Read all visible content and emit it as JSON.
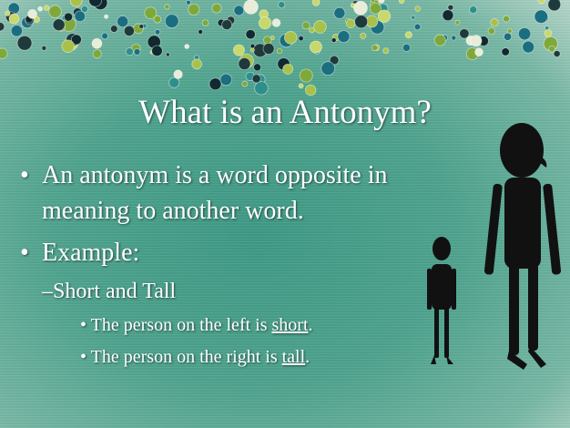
{
  "slide": {
    "title": "What is an Antonym?",
    "bullets": [
      {
        "bullet": "•",
        "line1": "An antonym is a word opposite in",
        "line2": "meaning to another word."
      },
      {
        "bullet": "•",
        "text": "Example:"
      }
    ],
    "sub_bullet": {
      "dash": "–",
      "text": "Short and Tall"
    },
    "sub_sub_bullets": [
      {
        "bullet": "•",
        "before": "The person on the left is ",
        "underlined": "short",
        "after": "."
      },
      {
        "bullet": "•",
        "before": "The person on the right is ",
        "underlined": "tall",
        "after": "."
      }
    ]
  },
  "colors": {
    "background": "#4fa48f",
    "text": "#ffffff",
    "silhouette": "#111111"
  },
  "decor": {
    "top_border": "beaded-dots",
    "image": "short-and-tall-person-silhouettes"
  }
}
